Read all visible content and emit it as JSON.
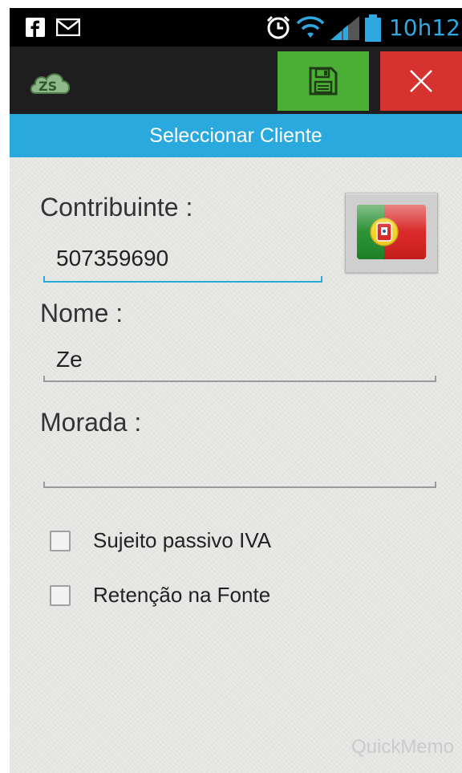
{
  "status_bar": {
    "time": "10h12",
    "icons": [
      "facebook-icon",
      "gmail-icon",
      "alarm-icon",
      "wifi-icon",
      "signal-icon",
      "battery-icon"
    ]
  },
  "action_bar": {
    "logo_text": "ZS",
    "save_icon": "floppy-disk-icon",
    "close_icon": "close-icon",
    "colors": {
      "save": "#4caf35",
      "close": "#d6322f"
    }
  },
  "title": "Seleccionar Cliente",
  "form": {
    "contribuinte": {
      "label": "Contribuinte :",
      "value": "507359690"
    },
    "nome": {
      "label": "Nome :",
      "value": "Ze"
    },
    "morada": {
      "label": "Morada :",
      "value": ""
    },
    "flag_button_icon": "portugal-flag-icon",
    "checkboxes": [
      {
        "label": "Sujeito passivo IVA",
        "checked": false
      },
      {
        "label": "Retenção na Fonte",
        "checked": false
      }
    ]
  },
  "watermark": "QuickMemo",
  "accent_color": "#2aa9de"
}
